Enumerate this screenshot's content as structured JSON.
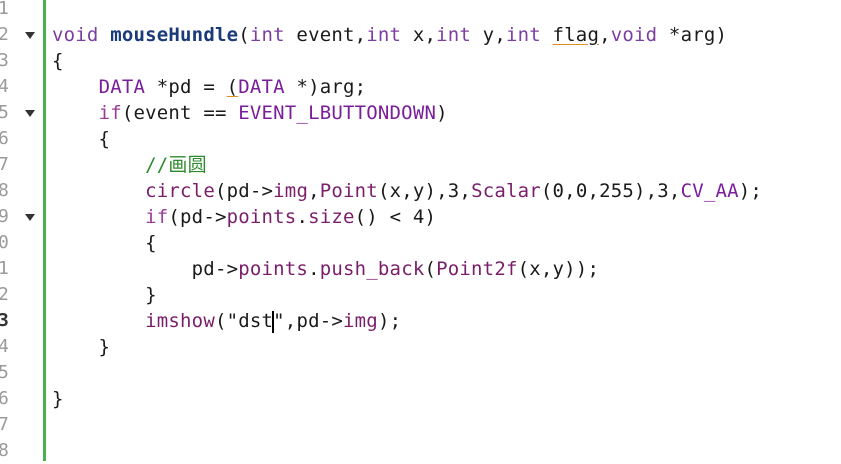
{
  "editor": {
    "current_line": "3",
    "line_numbers": [
      "1",
      "2",
      "3",
      "4",
      "5",
      "6",
      "7",
      "8",
      "9",
      "0",
      "1",
      "2",
      "3",
      "4",
      "5",
      "6",
      "7",
      "8"
    ],
    "lines": [
      [],
      [
        {
          "t": "void ",
          "c": "type"
        },
        {
          "t": "mouseHundle",
          "c": "fn"
        },
        {
          "t": "(",
          "c": "plain"
        },
        {
          "t": "int",
          "c": "type"
        },
        {
          "t": " event,",
          "c": "plain"
        },
        {
          "t": "int",
          "c": "type"
        },
        {
          "t": " x,",
          "c": "plain"
        },
        {
          "t": "int",
          "c": "type"
        },
        {
          "t": " y,",
          "c": "plain"
        },
        {
          "t": "int",
          "c": "type"
        },
        {
          "t": " ",
          "c": "plain"
        },
        {
          "t": "flag",
          "c": "plain ul"
        },
        {
          "t": ",",
          "c": "plain"
        },
        {
          "t": "void",
          "c": "type"
        },
        {
          "t": " *arg)",
          "c": "plain"
        }
      ],
      [
        {
          "t": "{",
          "c": "plain"
        }
      ],
      [
        {
          "t": "    ",
          "c": "plain"
        },
        {
          "t": "DATA",
          "c": "macro"
        },
        {
          "t": " *pd = ",
          "c": "plain"
        },
        {
          "t": "(",
          "c": "plain ul"
        },
        {
          "t": "DATA",
          "c": "macro"
        },
        {
          "t": " *)arg;",
          "c": "plain"
        }
      ],
      [
        {
          "t": "    ",
          "c": "plain"
        },
        {
          "t": "if",
          "c": "kw"
        },
        {
          "t": "(event == ",
          "c": "plain"
        },
        {
          "t": "EVENT_LBUTTONDOWN",
          "c": "macro"
        },
        {
          "t": ")",
          "c": "plain"
        }
      ],
      [
        {
          "t": "    {",
          "c": "plain"
        }
      ],
      [
        {
          "t": "        ",
          "c": "plain"
        },
        {
          "t": "//画圆",
          "c": "comment"
        }
      ],
      [
        {
          "t": "        ",
          "c": "plain"
        },
        {
          "t": "circle",
          "c": "call"
        },
        {
          "t": "(pd->",
          "c": "plain"
        },
        {
          "t": "img",
          "c": "member"
        },
        {
          "t": ",",
          "c": "plain"
        },
        {
          "t": "Point",
          "c": "call"
        },
        {
          "t": "(x,y),3,",
          "c": "plain"
        },
        {
          "t": "Scalar",
          "c": "call"
        },
        {
          "t": "(0,0,255),3,",
          "c": "plain"
        },
        {
          "t": "CV_AA",
          "c": "macro"
        },
        {
          "t": ");",
          "c": "plain"
        }
      ],
      [
        {
          "t": "        ",
          "c": "plain"
        },
        {
          "t": "if",
          "c": "kw"
        },
        {
          "t": "(pd->",
          "c": "plain"
        },
        {
          "t": "points",
          "c": "member"
        },
        {
          "t": ".",
          "c": "plain"
        },
        {
          "t": "size",
          "c": "call"
        },
        {
          "t": "() < 4)",
          "c": "plain"
        }
      ],
      [
        {
          "t": "        {",
          "c": "plain"
        }
      ],
      [
        {
          "t": "            pd->",
          "c": "plain"
        },
        {
          "t": "points",
          "c": "member"
        },
        {
          "t": ".",
          "c": "plain"
        },
        {
          "t": "push_back",
          "c": "call"
        },
        {
          "t": "(",
          "c": "plain"
        },
        {
          "t": "Point2f",
          "c": "call"
        },
        {
          "t": "(x,y));",
          "c": "plain"
        }
      ],
      [
        {
          "t": "        }",
          "c": "plain"
        }
      ],
      [
        {
          "t": "        ",
          "c": "plain"
        },
        {
          "t": "imshow",
          "c": "call"
        },
        {
          "t": "(\"dst",
          "c": "plain"
        },
        {
          "t": "|CURSOR|",
          "c": "cursor"
        },
        {
          "t": "\",pd->",
          "c": "plain"
        },
        {
          "t": "img",
          "c": "member"
        },
        {
          "t": ");",
          "c": "plain"
        }
      ],
      [
        {
          "t": "    }",
          "c": "plain"
        }
      ],
      [],
      [
        {
          "t": "}",
          "c": "plain"
        }
      ],
      [],
      []
    ],
    "fold_lines": [
      1,
      4,
      8
    ],
    "accent_bar_color": "#4caf50"
  }
}
